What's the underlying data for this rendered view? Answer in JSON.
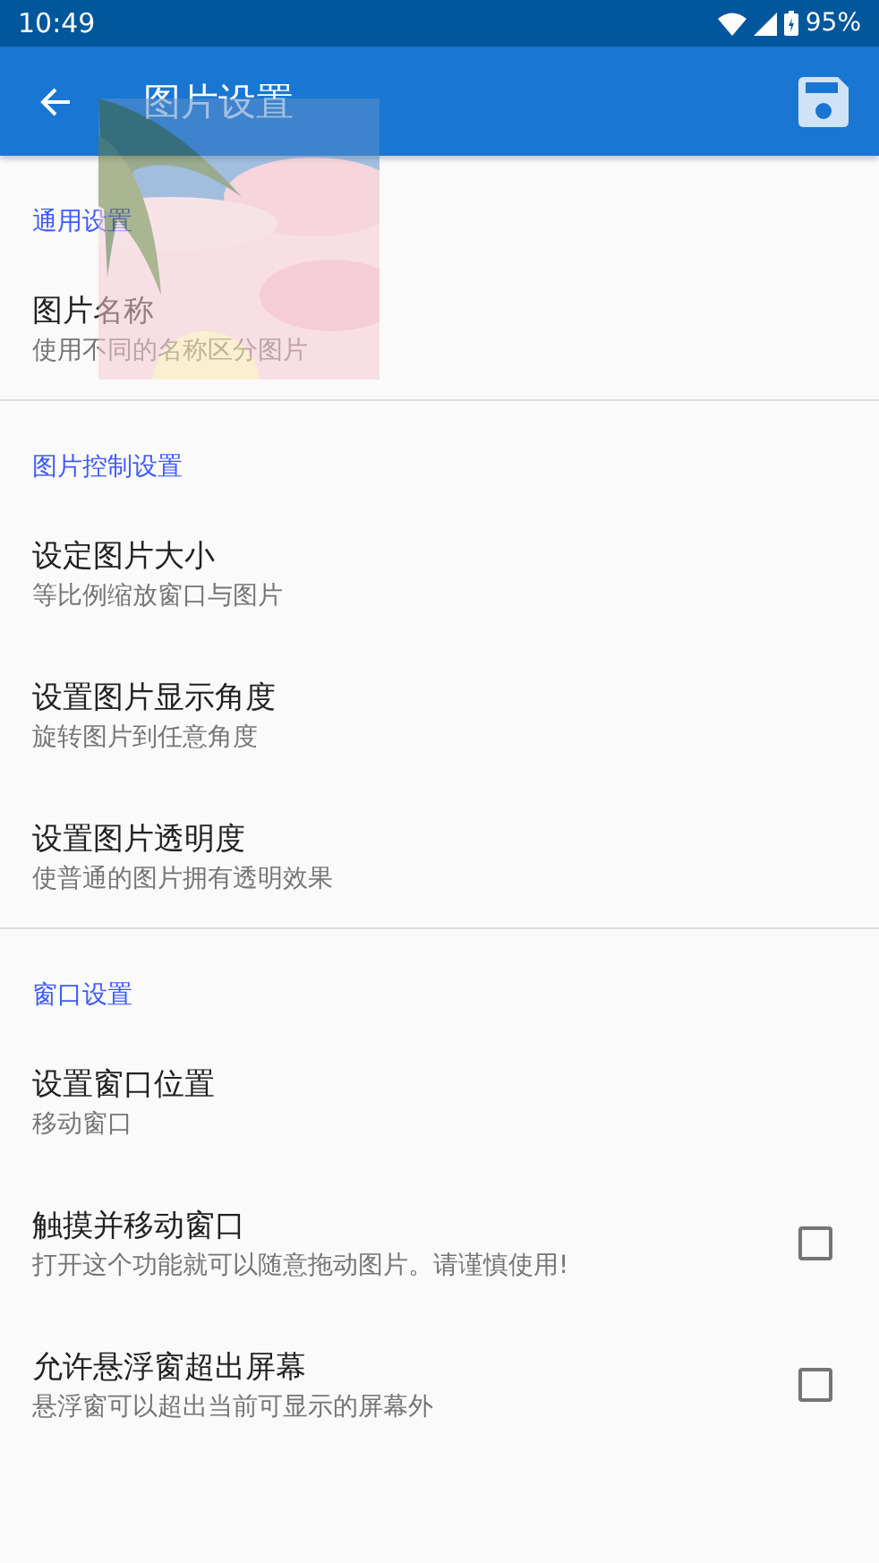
{
  "status_bar": {
    "time": "10:49",
    "battery": "95%"
  },
  "app_bar": {
    "title": "图片设置"
  },
  "sections": [
    {
      "title": "通用设置",
      "items": [
        {
          "kind": "text",
          "title": "图片名称",
          "summary": "使用不同的名称区分图片"
        }
      ]
    },
    {
      "title": "图片控制设置",
      "items": [
        {
          "kind": "text",
          "title": "设定图片大小",
          "summary": "等比例缩放窗口与图片"
        },
        {
          "kind": "text",
          "title": "设置图片显示角度",
          "summary": "旋转图片到任意角度"
        },
        {
          "kind": "text",
          "title": "设置图片透明度",
          "summary": "使普通的图片拥有透明效果"
        }
      ]
    },
    {
      "title": "窗口设置",
      "items": [
        {
          "kind": "text",
          "title": "设置窗口位置",
          "summary": "移动窗口"
        },
        {
          "kind": "checkbox",
          "title": "触摸并移动窗口",
          "summary": "打开这个功能就可以随意拖动图片。请谨慎使用!",
          "checked": false
        },
        {
          "kind": "checkbox",
          "title": "允许悬浮窗超出屏幕",
          "summary": "悬浮窗可以超出当前可显示的屏幕外",
          "checked": false
        }
      ]
    }
  ]
}
